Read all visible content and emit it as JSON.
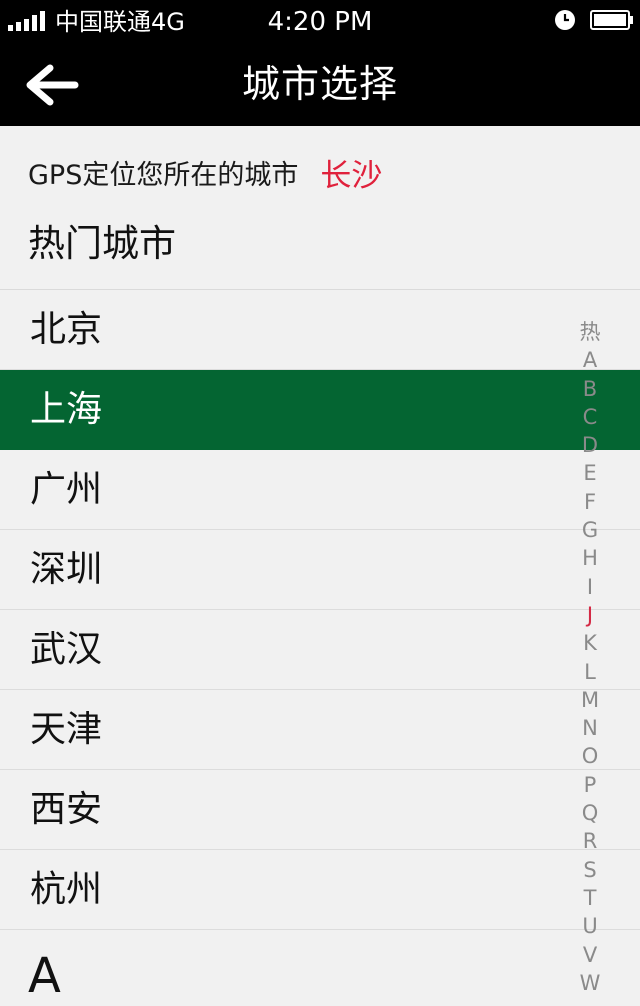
{
  "status_bar": {
    "carrier": "中国联通4G",
    "time": "4:20 PM",
    "signal_icon": "signal-bars-icon",
    "alarm_icon": "alarm-clock-icon",
    "battery_icon": "battery-full-icon"
  },
  "nav": {
    "back_icon": "arrow-left-icon",
    "title": "城市选择"
  },
  "gps": {
    "label": "GPS定位您所在的城市",
    "city": "长沙",
    "city_color": "#e0213c"
  },
  "hot_cities": {
    "heading": "热门城市",
    "items": [
      {
        "label": "北京"
      },
      {
        "label": "上海"
      },
      {
        "label": "广州"
      },
      {
        "label": "深圳"
      },
      {
        "label": "武汉"
      },
      {
        "label": "天津"
      },
      {
        "label": "西安"
      },
      {
        "label": "杭州"
      }
    ],
    "selected": "上海",
    "selected_color": "#046532"
  },
  "section_letter": "A",
  "alpha_index": {
    "items": [
      "热",
      "A",
      "B",
      "C",
      "D",
      "E",
      "F",
      "G",
      "H",
      "I",
      "J",
      "K",
      "L",
      "M",
      "N",
      "O",
      "P",
      "Q",
      "R",
      "S",
      "T",
      "U",
      "V",
      "W"
    ],
    "active": "J",
    "active_color": "#d42a45"
  }
}
